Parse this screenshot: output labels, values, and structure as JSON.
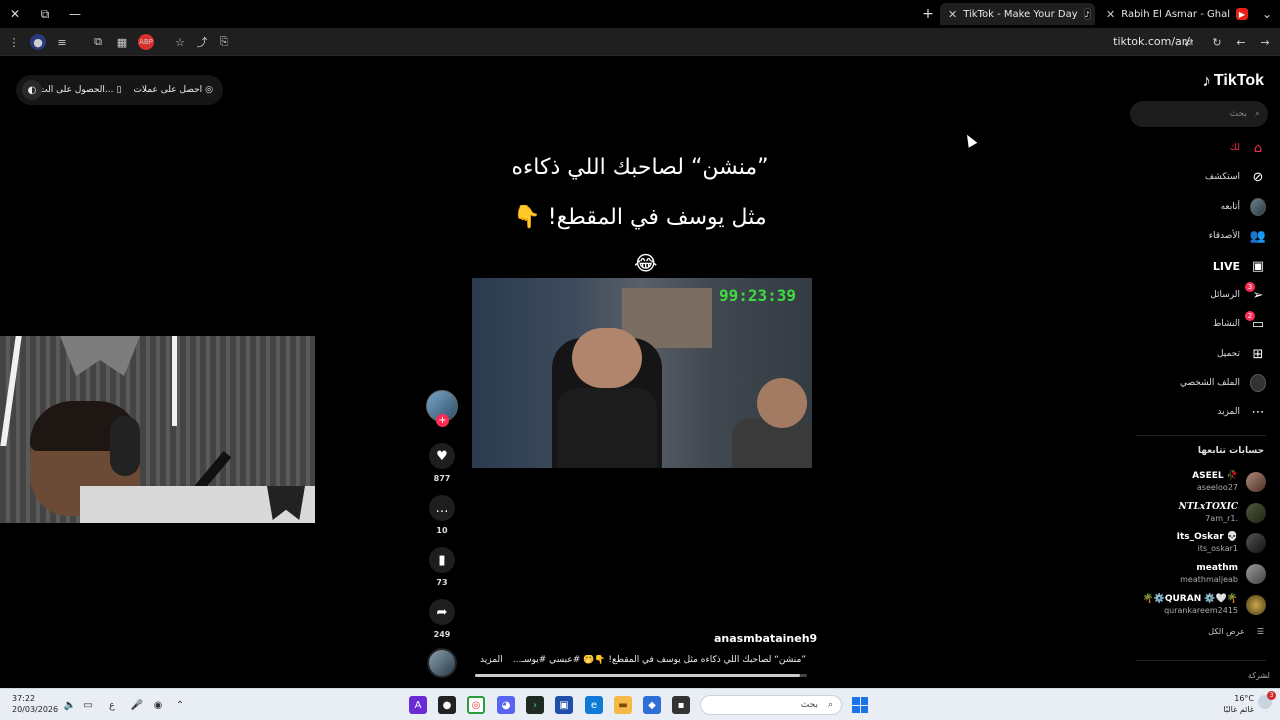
{
  "tabs": [
    {
      "title": "TikTok - Make Your Day",
      "active": true,
      "close": "✕"
    },
    {
      "title": "Rabih El Asmar - Ghalak / غلاك",
      "active": false,
      "close": "✕"
    }
  ],
  "window": {
    "close": "✕",
    "restore": "⧉",
    "minimize": "—",
    "new_tab": "+",
    "tab_menu": "⌄"
  },
  "toolbar": {
    "url": "tiktok.com/ar/"
  },
  "header": {
    "coin_pill": [
      {
        "label": "احصل على عملات",
        "icon": "coin-icon"
      },
      {
        "label": "الحصول على الت...",
        "icon": "phone-icon"
      }
    ]
  },
  "sidebar": {
    "logo": "TikTok",
    "search_placeholder": "بحث",
    "nav": [
      {
        "label": "لك",
        "icon": "home-icon"
      },
      {
        "label": "استكشف",
        "icon": "compass-icon"
      },
      {
        "label": "أتابعه",
        "icon": "avatar"
      },
      {
        "label": "الأصدقاء",
        "icon": "friends-icon"
      },
      {
        "label": "LIVE",
        "icon": "live-icon"
      },
      {
        "label": "الرسائل",
        "icon": "messages-icon",
        "badge": "3"
      },
      {
        "label": "النشاط",
        "icon": "activity-icon",
        "badge": "2"
      },
      {
        "label": "تحميل",
        "icon": "upload-icon"
      },
      {
        "label": "الملف الشخصي",
        "icon": "profile-avatar"
      },
      {
        "label": "المزيد",
        "icon": "more-icon"
      }
    ],
    "following_title": "حسابات تتابعها",
    "accounts": [
      {
        "name": "ASEEL 🥀",
        "handle": "aseeloo27"
      },
      {
        "name": "NTLxTOXIC",
        "handle": "7am_r1."
      },
      {
        "name": "Its_Oskar 💀",
        "handle": "its_oskar1"
      },
      {
        "name": "meathm",
        "handle": "meathmaljeab"
      },
      {
        "name": "🌴⚙️QURAN ⚙️🤍🌴",
        "handle": "qurankareem2415"
      }
    ],
    "see_all": "عرض الكل",
    "company": "لشركة"
  },
  "video": {
    "caption_line1": "”منشن“ لصاحبك اللي ذكاءه",
    "caption_line2": "مثل يوسف في المقطع! 👇",
    "caption_emoji": "😂",
    "timer": "99:23:39",
    "username": "anasmbataineh9",
    "description": "”منشن“ لصاحبك اللي ذكاءه مثل يوسف في المقطع! 👇🤭 #عبسي #يوسـ...",
    "more": "المزيد",
    "progress": 0.98
  },
  "actions": {
    "follow": "+",
    "likes": "877",
    "comments": "10",
    "saves": "73",
    "shares": "249"
  },
  "taskbar": {
    "time": "37:22",
    "date": "20/03/2026",
    "lang": "ع",
    "search_placeholder": "بحث",
    "weather_temp": "16°C",
    "weather_desc": "غائم غالبًا",
    "notification_count": "3"
  }
}
